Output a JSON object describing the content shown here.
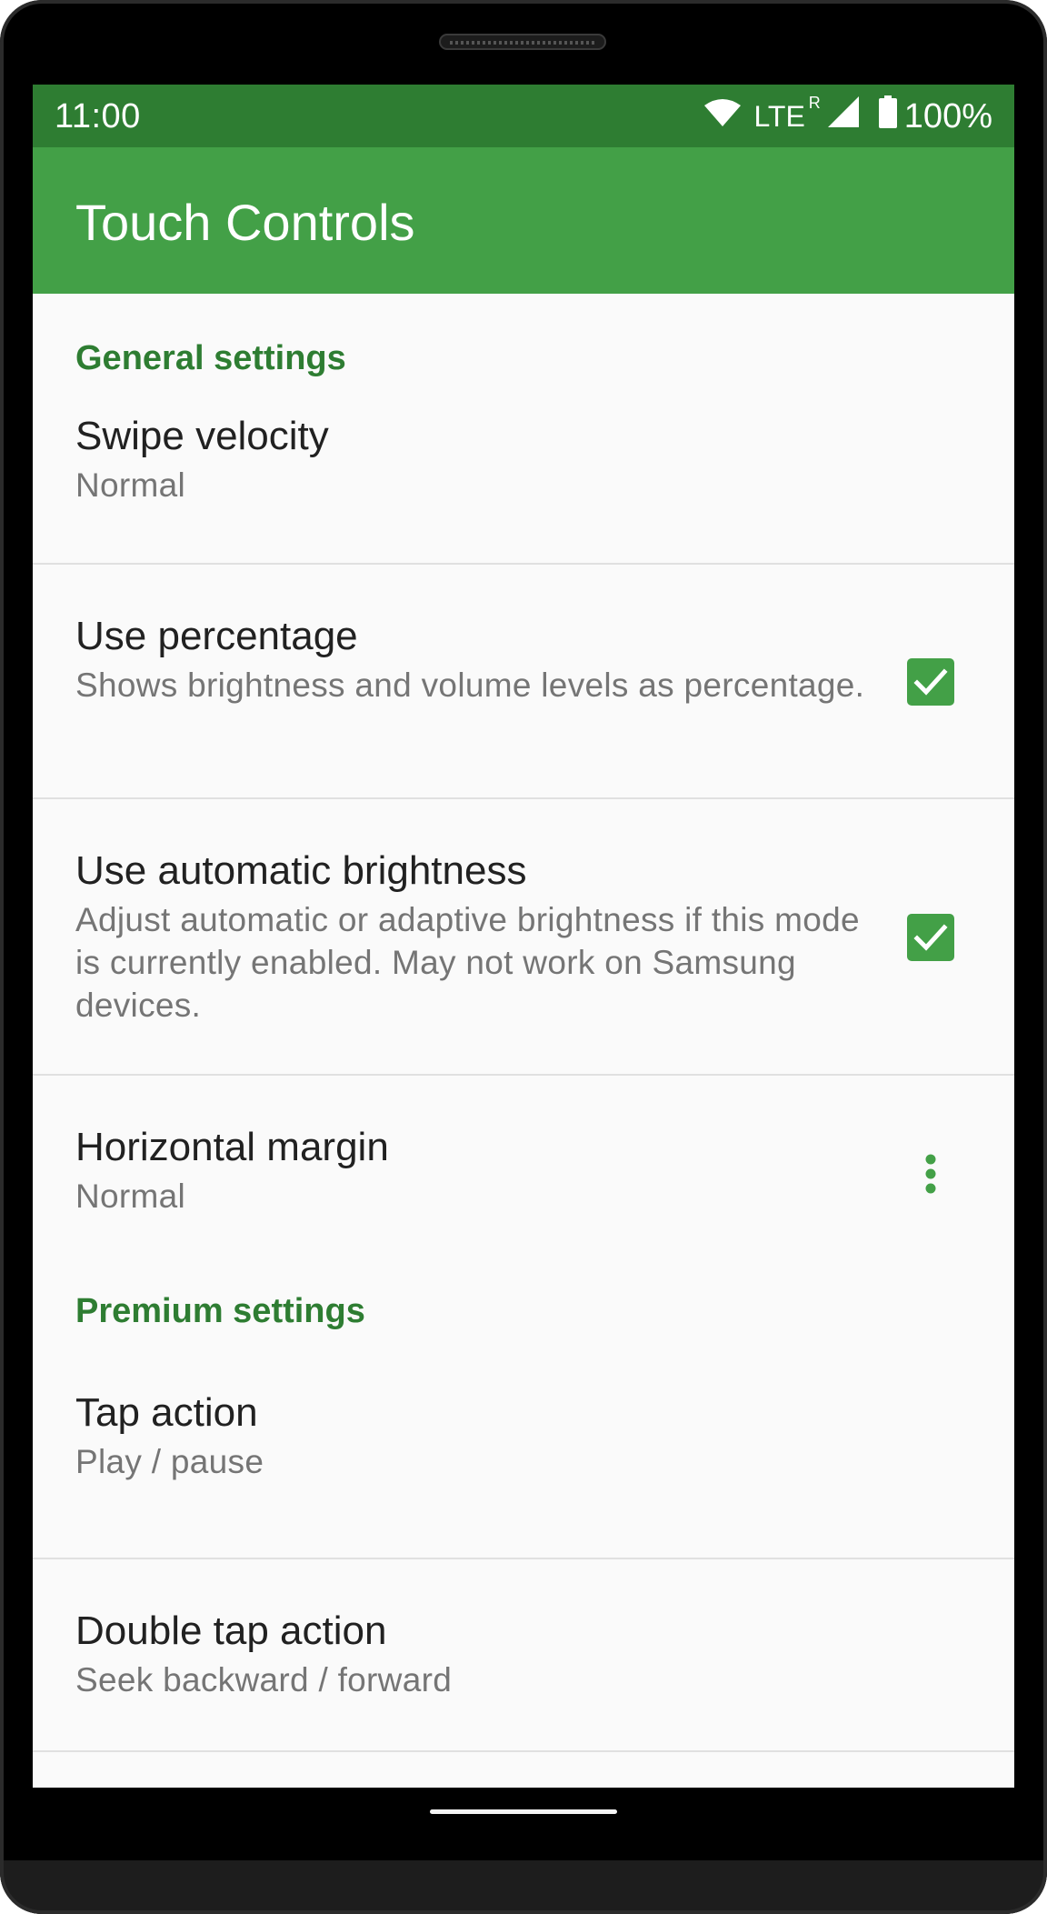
{
  "status_bar": {
    "time": "11:00",
    "network": "LTE",
    "roaming": "R",
    "battery": "100%"
  },
  "app_bar": {
    "title": "Touch Controls"
  },
  "colors": {
    "accent": "#43a047",
    "status_bar": "#2e7d32",
    "category_text": "#2e7d32"
  },
  "sections": [
    {
      "label": "General settings",
      "items": [
        {
          "title": "Swipe velocity",
          "summary": "Normal"
        },
        {
          "title": "Use percentage",
          "summary": "Shows brightness and volume levels as percentage.",
          "checked": true
        },
        {
          "title": "Use automatic brightness",
          "summary": "Adjust automatic or adaptive brightness if this mode is currently enabled. May not work on Samsung devices.",
          "checked": true
        },
        {
          "title": "Horizontal margin",
          "summary": "Normal",
          "widget": "more-vert-icon"
        }
      ]
    },
    {
      "label": "Premium settings",
      "items": [
        {
          "title": "Tap action",
          "summary": "Play / pause"
        },
        {
          "title": "Double tap action",
          "summary": "Seek backward / forward"
        }
      ]
    }
  ],
  "icons": {
    "wifi": "wifi-icon",
    "signal": "signal-icon",
    "battery": "battery-icon",
    "checkbox": "checkbox-checked-icon",
    "more": "more-vert-icon"
  }
}
